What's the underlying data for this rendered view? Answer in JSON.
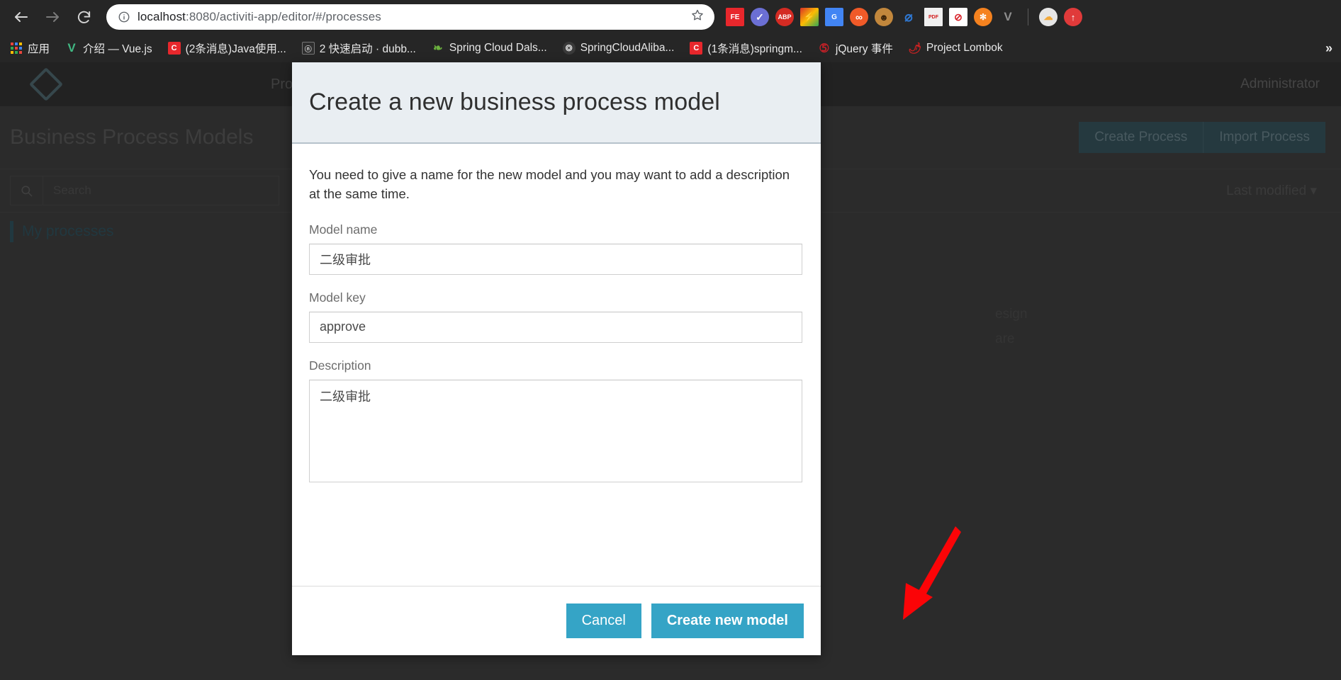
{
  "browser": {
    "back_icon": "back-arrow-icon",
    "forward_icon": "forward-arrow-icon",
    "reload_icon": "reload-icon",
    "info_icon": "site-info-icon",
    "star_icon": "bookmark-star-icon",
    "url_prefix": "localhost",
    "url_suffix": ":8080/activiti-app/editor/#/processes",
    "url_full": "localhost:8080/activiti-app/editor/#/processes",
    "extensions": [
      {
        "name": "fe-extension-icon",
        "label": "FE",
        "bg": "#e8272c",
        "fg": "#ffffff"
      },
      {
        "name": "checkmark-circle-extension-icon",
        "label": "✓",
        "bg": "#6b6fd4",
        "fg": "#ffffff"
      },
      {
        "name": "adblock-plus-extension-icon",
        "label": "ABP",
        "bg": "#d42b23",
        "fg": "#ffffff"
      },
      {
        "name": "colorful-lightning-extension-icon",
        "label": "⚡",
        "bg": "#f7c325",
        "fg": "#333333"
      },
      {
        "name": "google-translate-extension-icon",
        "label": "G",
        "bg": "#4285f4",
        "fg": "#ffffff"
      },
      {
        "name": "infinity-extension-icon",
        "label": "∞",
        "bg": "#f05a28",
        "fg": "#ffffff"
      },
      {
        "name": "monkey-face-extension-icon",
        "label": "☺",
        "bg": "#c98a3a",
        "fg": "#4a2c10"
      },
      {
        "name": "leaf-pen-extension-icon",
        "label": "⌀",
        "bg": "#ffffff",
        "fg": "#1f6fd0"
      },
      {
        "name": "pdfjs-extension-icon",
        "label": "PDF",
        "bg": "#f2f2f2",
        "fg": "#d11a1a"
      },
      {
        "name": "block-site-extension-icon",
        "label": "⊘",
        "bg": "#ffffff",
        "fg": "#d8232a"
      },
      {
        "name": "orange-dot-extension-icon",
        "label": "●",
        "bg": "#f5821f",
        "fg": "#ffffff"
      },
      {
        "name": "vue-devtools-extension-icon",
        "label": "V",
        "bg": "#262626",
        "fg": "#9a9a9a"
      },
      {
        "name": "weather-extension-icon",
        "label": "☁",
        "bg": "#e6e6e6",
        "fg": "#f6b93b"
      },
      {
        "name": "upload-arrow-extension-icon",
        "label": "↑",
        "bg": "#e03a3a",
        "fg": "#ffffff"
      }
    ],
    "bookmarks": [
      {
        "name": "bookmark-apps",
        "label": "应用",
        "icon": "apps-grid-icon",
        "icon_text": "",
        "bg": "",
        "fg": ""
      },
      {
        "name": "bookmark-vuejs",
        "label": "介绍 — Vue.js",
        "icon": "vue-logo-icon",
        "icon_text": "V",
        "bg": "",
        "fg": "#41b883"
      },
      {
        "name": "bookmark-csdn-java",
        "label": "(2条消息)Java使用...",
        "icon": "csdn-icon",
        "icon_text": "C",
        "bg": "#e8272c",
        "fg": "#ffffff"
      },
      {
        "name": "bookmark-dubbo",
        "label": "2 快速启动 · dubb...",
        "icon": "dubbo-icon",
        "icon_text": "ⓝ",
        "bg": "#2a2a2a",
        "fg": "#dcdcdc"
      },
      {
        "name": "bookmark-spring-cloud-dals",
        "label": "Spring Cloud Dals...",
        "icon": "spring-leaf-icon",
        "icon_text": "✿",
        "bg": "",
        "fg": "#6db33f"
      },
      {
        "name": "bookmark-springcloudalibaba",
        "label": "SpringCloudAliba...",
        "icon": "github-icon",
        "icon_text": "●",
        "bg": "#2f2f2f",
        "fg": "#b5b5b5"
      },
      {
        "name": "bookmark-csdn-springm",
        "label": "(1条消息)springm...",
        "icon": "csdn-icon",
        "icon_text": "C",
        "bg": "#e8272c",
        "fg": "#ffffff"
      },
      {
        "name": "bookmark-jquery-events",
        "label": "jQuery 事件",
        "icon": "jquery-icon",
        "icon_text": "⑤",
        "bg": "",
        "fg": "#cb2027"
      },
      {
        "name": "bookmark-project-lombok",
        "label": "Project Lombok",
        "icon": "chili-pepper-icon",
        "icon_text": "🌶",
        "bg": "",
        "fg": "#cc2222"
      }
    ],
    "bookmarks_overflow": "»"
  },
  "app": {
    "logo": "activiti-diamond-logo",
    "nav": [
      {
        "name": "nav-processes",
        "label": "Processes"
      }
    ],
    "user": "Administrator",
    "page_title": "Business Process Models",
    "actions": [
      {
        "name": "create-process-button",
        "label": "Create Process"
      },
      {
        "name": "import-process-button",
        "label": "Import Process"
      }
    ],
    "search_placeholder": "Search",
    "search_icon": "search-magnifier-icon",
    "sort_label": "Last modified",
    "sort_caret": "▾",
    "tabs": [
      {
        "name": "tab-my-processes",
        "label": "My processes"
      }
    ],
    "ghost_cards": [
      {
        "name": "ghost-card-design-label",
        "label": "esign"
      },
      {
        "name": "ghost-card-share-label",
        "label": "are"
      }
    ]
  },
  "modal": {
    "title": "Create a new business process model",
    "intro": "You need to give a name for the new model and you may want to add a description at the same time.",
    "fields": {
      "model_name": {
        "label": "Model name",
        "value": "二级审批",
        "placeholder": ""
      },
      "model_key": {
        "label": "Model key",
        "value": "approve",
        "placeholder": ""
      },
      "description": {
        "label": "Description",
        "value": "二级审批",
        "placeholder": ""
      }
    },
    "cancel_label": "Cancel",
    "submit_label": "Create new model",
    "accent_color": "#35a4c6",
    "header_bg": "#e9eef2"
  },
  "annotation": {
    "arrow_color": "#fb0407",
    "arrow_name": "red-pointer-arrow-to-create-new-model"
  }
}
